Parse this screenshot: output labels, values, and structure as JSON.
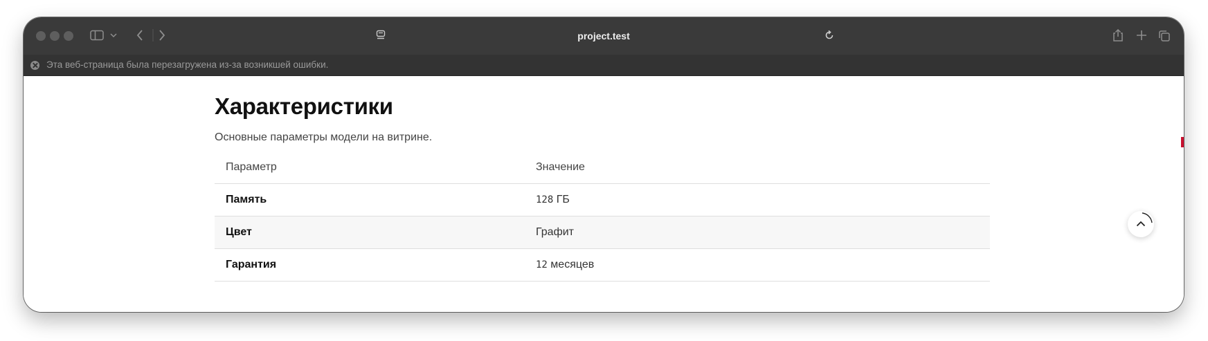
{
  "browser": {
    "url": "project.test",
    "error_banner": "Эта веб-страница была перезагружена из-за возникшей ошибки.",
    "icons": [
      "sidebar-icon",
      "chevron-down-icon",
      "back-icon",
      "forward-icon",
      "reader-icon",
      "reload-icon",
      "share-icon",
      "new-tab-icon",
      "tabs-overview-icon",
      "error-icon"
    ]
  },
  "page": {
    "title": "Характеристики",
    "subtitle": "Основные параметры модели на витрине.",
    "table": {
      "headers": [
        "Параметр",
        "Значение"
      ],
      "rows": [
        {
          "param": "Память",
          "num": "128",
          "unit": " ГБ"
        },
        {
          "param": "Цвет",
          "value": "Графит"
        },
        {
          "param": "Гарантия",
          "num": "12",
          "unit": " месяцев"
        }
      ]
    },
    "scroll_top_icon": "chevron-up-icon"
  },
  "colors": {
    "toolbar": "#3a3a3a",
    "infobar": "#333333",
    "accent_marker": "#c8102e"
  }
}
